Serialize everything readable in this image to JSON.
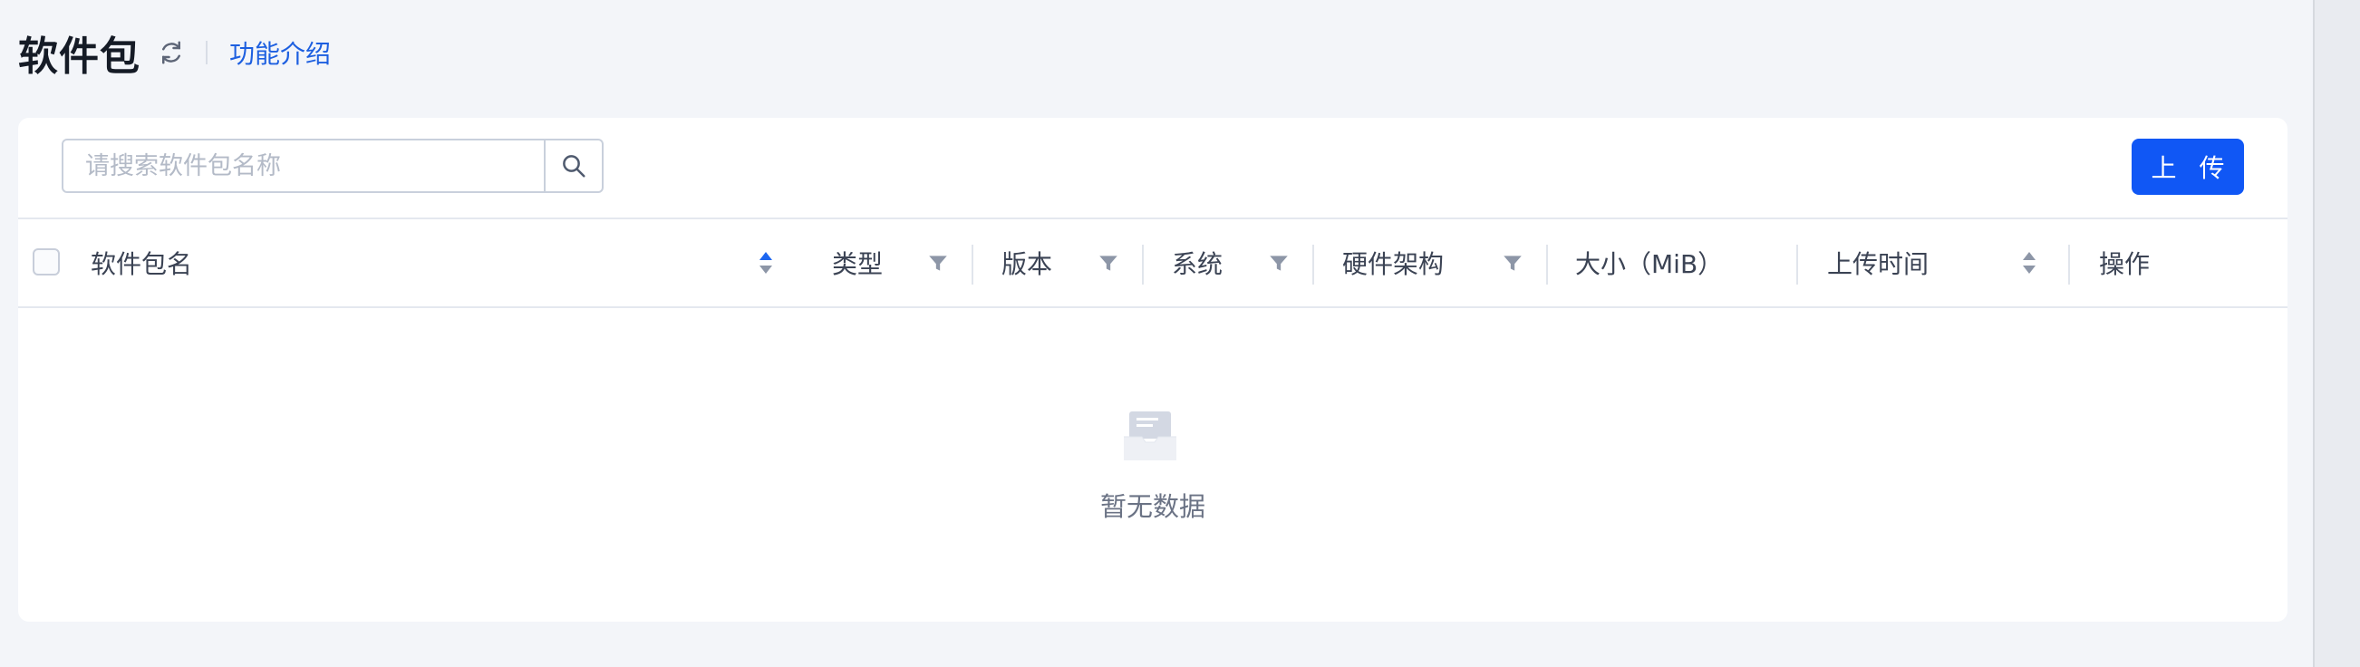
{
  "page": {
    "title": "软件包",
    "intro_link": "功能介绍"
  },
  "toolbar": {
    "search_placeholder": "请搜索软件包名称",
    "upload_label": "上 传"
  },
  "table": {
    "columns": [
      {
        "label": "软件包名",
        "control": "sort-active-up"
      },
      {
        "label": "类型",
        "control": "filter"
      },
      {
        "label": "版本",
        "control": "filter"
      },
      {
        "label": "系统",
        "control": "filter"
      },
      {
        "label": "硬件架构",
        "control": "filter"
      },
      {
        "label": "大小（MiB）",
        "control": "none"
      },
      {
        "label": "上传时间",
        "control": "sort"
      },
      {
        "label": "操作",
        "control": "none"
      }
    ],
    "empty_text": "暂无数据"
  },
  "colors": {
    "primary": "#1057f5",
    "link": "#1d5fe0",
    "background": "#f3f5f9",
    "card": "#ffffff"
  },
  "icons": {
    "refresh": "refresh-icon",
    "search": "search-icon",
    "filter": "filter-icon",
    "sort": "sort-icon",
    "empty": "empty-inbox-icon"
  }
}
